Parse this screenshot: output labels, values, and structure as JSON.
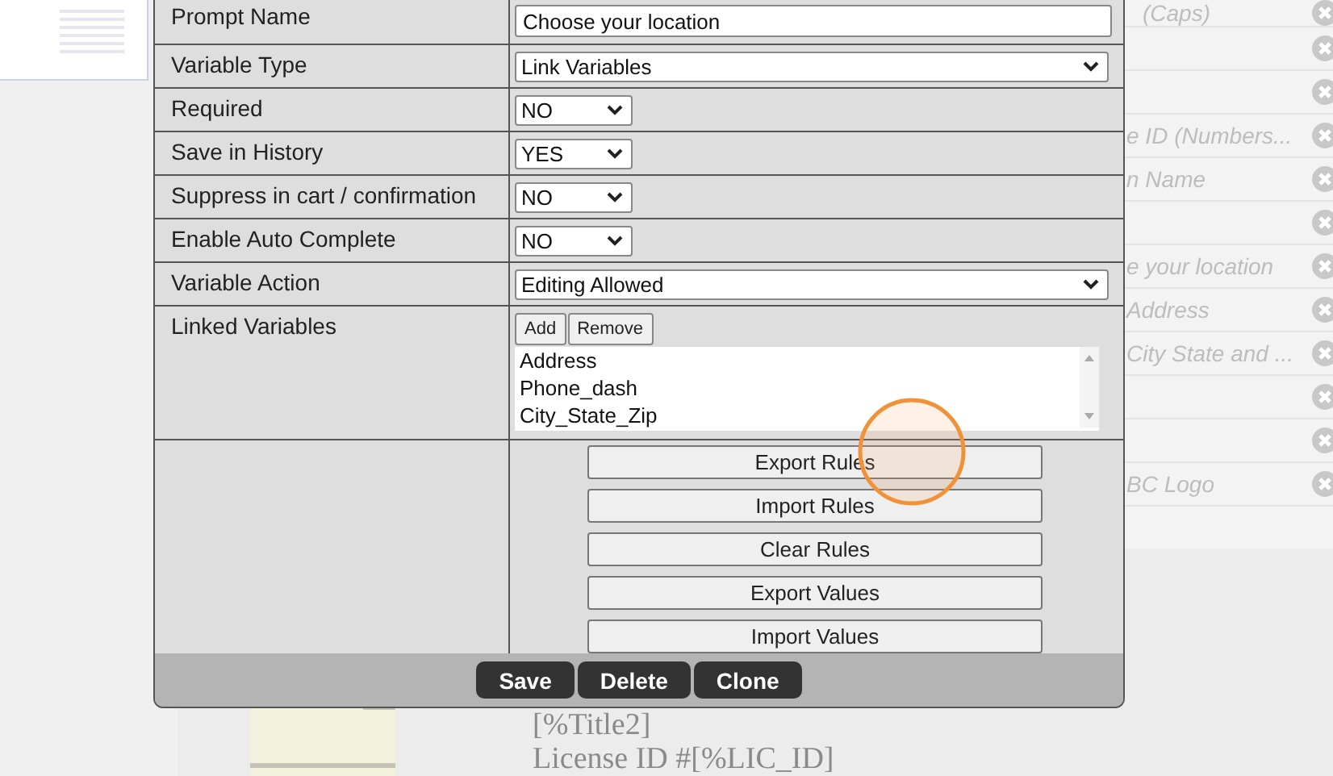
{
  "background": {
    "list_items": [
      {
        "kind": "text",
        "text": "(Caps)"
      },
      {
        "kind": "blank"
      },
      {
        "kind": "blank"
      },
      {
        "text": "e ID (Numbers..."
      },
      {
        "text": "n Name"
      },
      {
        "kind": "blank"
      },
      {
        "text": "e your location"
      },
      {
        "text": "Address"
      },
      {
        "text": "City State and ..."
      },
      {
        "kind": "blank"
      },
      {
        "kind": "blank"
      },
      {
        "text": "BC Logo"
      }
    ],
    "footer_texts": [
      "[%Title2]",
      "License ID #[%LIC_ID]"
    ]
  },
  "dialog": {
    "fields": [
      {
        "kind": "text",
        "label": "Prompt Name",
        "value": "Choose your location"
      },
      {
        "kind": "select-wide",
        "label": "Variable Type",
        "value": "Link Variables"
      },
      {
        "kind": "select",
        "label": "Required",
        "value": "NO"
      },
      {
        "kind": "select",
        "label": "Save in History",
        "value": "YES"
      },
      {
        "kind": "select",
        "label": "Suppress in cart / confirmation",
        "value": "NO"
      },
      {
        "kind": "select",
        "label": "Enable Auto Complete",
        "value": "NO"
      },
      {
        "kind": "select-wide",
        "label": "Variable Action",
        "value": "Editing Allowed"
      }
    ],
    "linked": {
      "label": "Linked Variables",
      "buttons": [
        "Add",
        "Remove"
      ],
      "items": [
        "Address",
        "Phone_dash",
        "City_State_Zip"
      ]
    },
    "tools": [
      "Export Rules",
      "Import Rules",
      "Clear Rules",
      "Export Values",
      "Import Values"
    ],
    "actions": [
      "Save",
      "Delete",
      "Clone"
    ]
  }
}
